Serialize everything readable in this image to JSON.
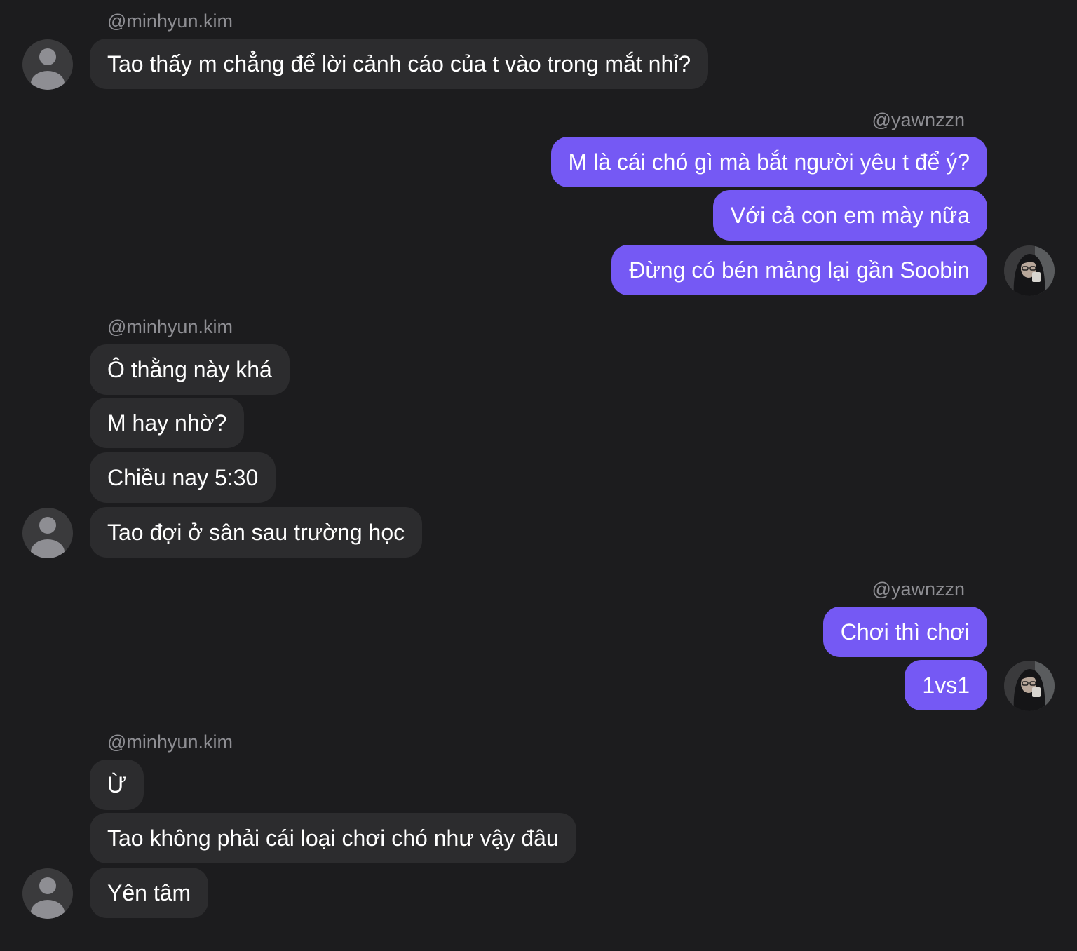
{
  "conversation": [
    {
      "sender": "@minhyun.kim",
      "direction": "in",
      "messages": [
        "Tao thấy m chẳng để lời cảnh cáo của t vào trong mắt nhỉ?"
      ]
    },
    {
      "sender": "@yawnzzn",
      "direction": "out",
      "messages": [
        "M là cái chó gì mà bắt người yêu t để ý?",
        "Với cả con em mày nữa",
        "Đừng có bén mảng lại gần Soobin"
      ]
    },
    {
      "sender": "@minhyun.kim",
      "direction": "in",
      "messages": [
        "Ô thằng này khá",
        "M hay nhờ?",
        "Chiều nay 5:30",
        "Tao đợi ở sân sau trường học"
      ]
    },
    {
      "sender": "@yawnzzn",
      "direction": "out",
      "messages": [
        "Chơi thì chơi",
        "1vs1"
      ]
    },
    {
      "sender": "@minhyun.kim",
      "direction": "in",
      "messages": [
        "Ừ",
        "Tao không phải cái loại chơi chó như vậy đâu",
        "Yên tâm"
      ]
    }
  ],
  "colors": {
    "background": "#1c1c1e",
    "incoming_bubble": "#2c2c2e",
    "outgoing_bubble": "#7559f4",
    "sender_name": "#8e8e93",
    "message_text": "#ffffff"
  },
  "icons": {
    "incoming_avatar": "default-person-icon",
    "outgoing_avatar": "user-photo-avatar"
  }
}
